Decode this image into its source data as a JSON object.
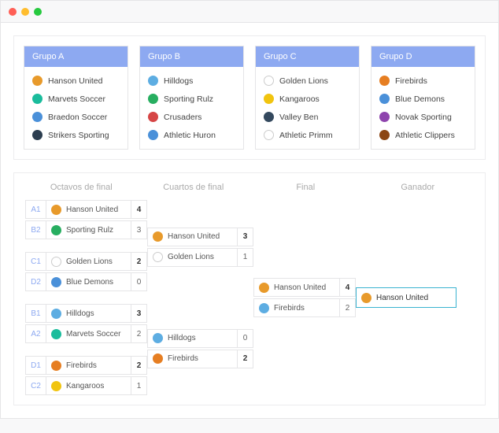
{
  "groups": [
    {
      "title": "Grupo A",
      "teams": [
        {
          "name": "Hanson United",
          "color": "c-orange"
        },
        {
          "name": "Marvets Soccer",
          "color": "c-teal"
        },
        {
          "name": "Braedon Soccer",
          "color": "c-blue"
        },
        {
          "name": "Strikers Sporting",
          "color": "c-navy"
        }
      ]
    },
    {
      "title": "Grupo B",
      "teams": [
        {
          "name": "Hilldogs",
          "color": "c-cyan"
        },
        {
          "name": "Sporting Rulz",
          "color": "c-green"
        },
        {
          "name": "Crusaders",
          "color": "c-red"
        },
        {
          "name": "Athletic Huron",
          "color": "c-blue"
        }
      ]
    },
    {
      "title": "Grupo C",
      "teams": [
        {
          "name": "Golden Lions",
          "color": "c-white"
        },
        {
          "name": "Kangaroos",
          "color": "c-yellow"
        },
        {
          "name": "Valley Ben",
          "color": "c-dark"
        },
        {
          "name": "Athletic Primm",
          "color": "c-white"
        }
      ]
    },
    {
      "title": "Grupo D",
      "teams": [
        {
          "name": "Firebirds",
          "color": "c-firered"
        },
        {
          "name": "Blue Demons",
          "color": "c-blue"
        },
        {
          "name": "Novak Sporting",
          "color": "c-purple"
        },
        {
          "name": "Athletic Clippers",
          "color": "c-maroon"
        }
      ]
    }
  ],
  "rounds": {
    "r16": "Octavos de final",
    "qf": "Cuartos de final",
    "sf": "Final",
    "winner": "Ganador"
  },
  "bracket": {
    "r16": [
      [
        {
          "seed": "A1",
          "name": "Hanson United",
          "color": "c-orange",
          "score": "4",
          "win": true
        },
        {
          "seed": "B2",
          "name": "Sporting Rulz",
          "color": "c-green",
          "score": "3",
          "win": false
        }
      ],
      [
        {
          "seed": "C1",
          "name": "Golden Lions",
          "color": "c-white",
          "score": "2",
          "win": true
        },
        {
          "seed": "D2",
          "name": "Blue Demons",
          "color": "c-blue",
          "score": "0",
          "win": false
        }
      ],
      [
        {
          "seed": "B1",
          "name": "Hilldogs",
          "color": "c-cyan",
          "score": "3",
          "win": true
        },
        {
          "seed": "A2",
          "name": "Marvets Soccer",
          "color": "c-teal",
          "score": "2",
          "win": false
        }
      ],
      [
        {
          "seed": "D1",
          "name": "Firebirds",
          "color": "c-firered",
          "score": "2",
          "win": true
        },
        {
          "seed": "C2",
          "name": "Kangaroos",
          "color": "c-yellow",
          "score": "1",
          "win": false
        }
      ]
    ],
    "qf": [
      [
        {
          "name": "Hanson United",
          "color": "c-orange",
          "score": "3",
          "win": true
        },
        {
          "name": "Golden Lions",
          "color": "c-white",
          "score": "1",
          "win": false
        }
      ],
      [
        {
          "name": "Hilldogs",
          "color": "c-cyan",
          "score": "0",
          "win": false
        },
        {
          "name": "Firebirds",
          "color": "c-firered",
          "score": "2",
          "win": true
        }
      ]
    ],
    "sf": [
      [
        {
          "name": "Hanson United",
          "color": "c-orange",
          "score": "4",
          "win": true
        },
        {
          "name": "Firebirds",
          "color": "c-cyan",
          "score": "2",
          "win": false
        }
      ]
    ],
    "winner": {
      "name": "Hanson United",
      "color": "c-orange"
    }
  }
}
